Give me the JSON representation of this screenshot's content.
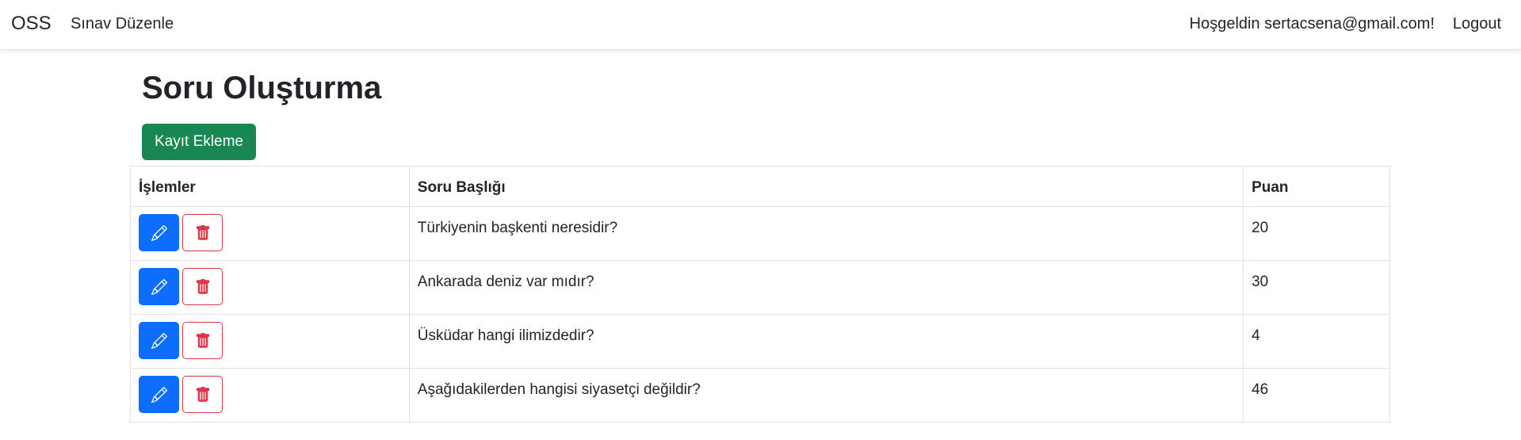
{
  "navbar": {
    "brand": "OSS",
    "edit_link": "Sınav Düzenle",
    "welcome": "Hoşgeldin sertacsena@gmail.com!",
    "logout": "Logout"
  },
  "page": {
    "title": "Soru Oluşturma",
    "add_button": "Kayıt Ekleme"
  },
  "table": {
    "headers": {
      "actions": "İşlemler",
      "title": "Soru Başlığı",
      "score": "Puan"
    },
    "rows": [
      {
        "title": "Türkiyenin başkenti neresidir?",
        "score": "20"
      },
      {
        "title": "Ankarada deniz var mıdır?",
        "score": "30"
      },
      {
        "title": "Üsküdar hangi ilimizdedir?",
        "score": "4"
      },
      {
        "title": "Aşağıdakilerden hangisi siyasetçi değildir?",
        "score": "46"
      }
    ]
  },
  "colors": {
    "primary": "#0d6efd",
    "success": "#198754",
    "danger": "#dc3545"
  },
  "icons": {
    "edit": "pencil-icon",
    "delete": "trash-icon"
  }
}
